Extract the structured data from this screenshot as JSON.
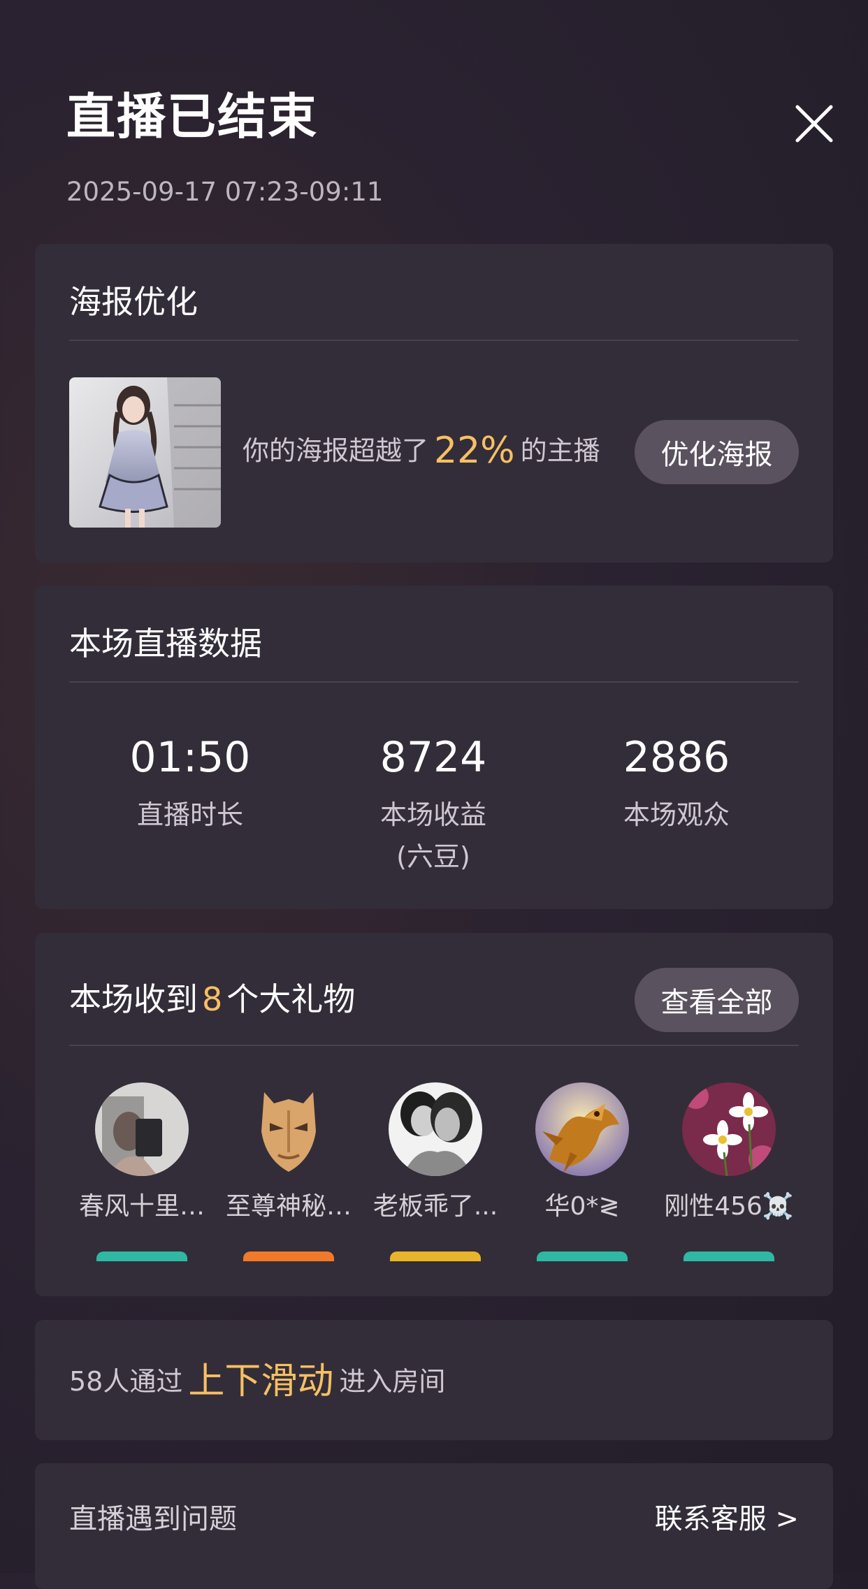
{
  "header": {
    "title": "直播已结束",
    "time_range": "2025-09-17 07:23-09:11"
  },
  "poster": {
    "title": "海报优化",
    "text_before": "你的海报超越了",
    "percent": "22%",
    "text_after": "的主播",
    "button_label": "优化海报"
  },
  "stats": {
    "title": "本场直播数据",
    "items": [
      {
        "value": "01:50",
        "label": "直播时长"
      },
      {
        "value": "8724",
        "label": "本场收益\n(六豆)"
      },
      {
        "value": "2886",
        "label": "本场观众"
      }
    ]
  },
  "gifts": {
    "title_before": "本场收到",
    "count": "8",
    "title_after": "个大礼物",
    "view_all_label": "查看全部",
    "gifters": [
      {
        "name": "春风十里…",
        "avatar": "person-selfie"
      },
      {
        "name": "至尊神秘…",
        "avatar": "gold-mask"
      },
      {
        "name": "老板乖了...",
        "avatar": "couple-bw"
      },
      {
        "name": "华0*≷",
        "avatar": "golden-dragon"
      },
      {
        "name": "刚性456☠️",
        "avatar": "white-flowers"
      }
    ],
    "badge_colors": [
      "#2fb8a4",
      "#f07a2a",
      "#e8b52a",
      "#2fb8a4",
      "#2fb8a4"
    ]
  },
  "swipe": {
    "text_before": "58人通过",
    "highlight": "上下滑动",
    "text_after": "进入房间"
  },
  "help": {
    "label": "直播遇到问题",
    "link": "联系客服 >"
  },
  "colors": {
    "accent": "#f6c063",
    "card": "#332d39",
    "pill": "#5b525f"
  }
}
